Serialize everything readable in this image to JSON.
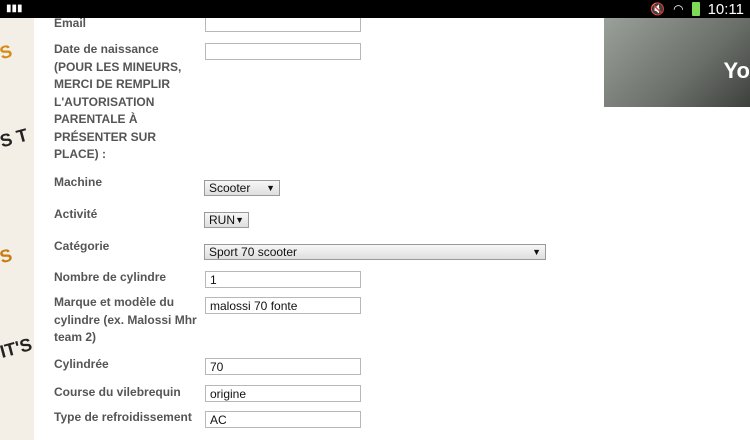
{
  "statusbar": {
    "left_icon": "signal-icon",
    "icons": [
      "mute-icon",
      "wifi-icon",
      "battery-icon"
    ],
    "time": "10:11"
  },
  "sidebar": {
    "video_text": "Yo"
  },
  "decor": [
    "S",
    "S T",
    "S",
    "IT'S"
  ],
  "form": {
    "email": {
      "label": "Email",
      "value": ""
    },
    "birth": {
      "label": "Date de naissance (POUR LES MINEURS, MERCI DE REMPLIR L'AUTORISATION PARENTALE À PRÉSENTER SUR PLACE) :",
      "value": ""
    },
    "machine": {
      "label": "Machine",
      "value": "Scooter"
    },
    "activite": {
      "label": "Activité",
      "value": "RUN"
    },
    "categorie": {
      "label": "Catégorie",
      "value": "Sport 70 scooter"
    },
    "cylindre_nb": {
      "label": "Nombre de cylindre",
      "value": "1"
    },
    "marque": {
      "label": "Marque et modèle du cylindre (ex. Malossi Mhr team 2)",
      "value": "malossi 70 fonte"
    },
    "cylindree": {
      "label": "Cylindrée",
      "value": "70"
    },
    "course": {
      "label": "Course du vilebrequin",
      "value": "origine"
    },
    "refroid": {
      "label": "Type de refroidissement",
      "value": "AC"
    }
  },
  "colors": {
    "label": "#555555",
    "border": "#b7b7b7",
    "statusbar": "#000000",
    "battery": "#7ed957",
    "accent_decor": "#d58b18"
  }
}
